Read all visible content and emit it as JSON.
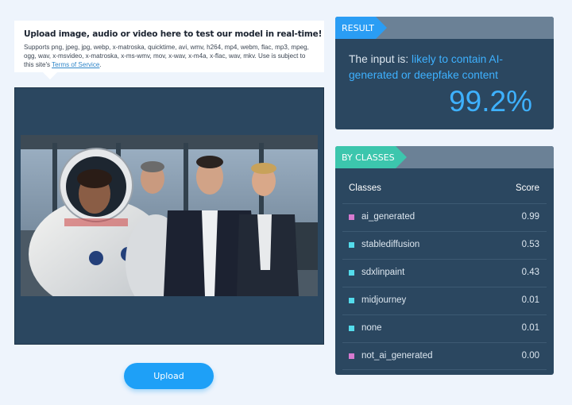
{
  "upload": {
    "title": "Upload image, audio or video here to test our model in real-time!",
    "formats": "Supports png, jpeg, jpg, webp, x-matroska, quicktime, avi, wmv, h264, mp4, webm, flac, mp3, mpeg, ogg, wav, x-msvideo, x-matroska, x-ms-wmv, mov, x-wav, x-m4a, x-flac, wav, mkv. Use is subject to this site's",
    "tos_link": "Terms of Service",
    "tos_period": ".",
    "button_label": "Upload"
  },
  "preview": {
    "image_subject": "four people in a control room, one in a white astronaut suit with helmet"
  },
  "result": {
    "tag": "RESULT",
    "prefix": "The input is: ",
    "verdict": "likely to contain AI-generated or deepfake content",
    "score": "99.2%"
  },
  "classes": {
    "tag": "BY CLASSES",
    "col_classes": "Classes",
    "col_score": "Score",
    "rows": [
      {
        "name": "ai_generated",
        "score": "0.99",
        "color": "#d77ad0"
      },
      {
        "name": "stablediffusion",
        "score": "0.53",
        "color": "#54dcec"
      },
      {
        "name": "sdxlinpaint",
        "score": "0.43",
        "color": "#54dcec"
      },
      {
        "name": "midjourney",
        "score": "0.01",
        "color": "#54dcec"
      },
      {
        "name": "none",
        "score": "0.01",
        "color": "#54dcec"
      },
      {
        "name": "not_ai_generated",
        "score": "0.00",
        "color": "#d77ad0"
      }
    ]
  },
  "colors": {
    "page_bg": "#eef4fc",
    "panel_bg": "#2b4760",
    "accent_blue": "#2a9df4",
    "accent_teal": "#3cc6ad",
    "score_blue": "#3eb1ff"
  }
}
